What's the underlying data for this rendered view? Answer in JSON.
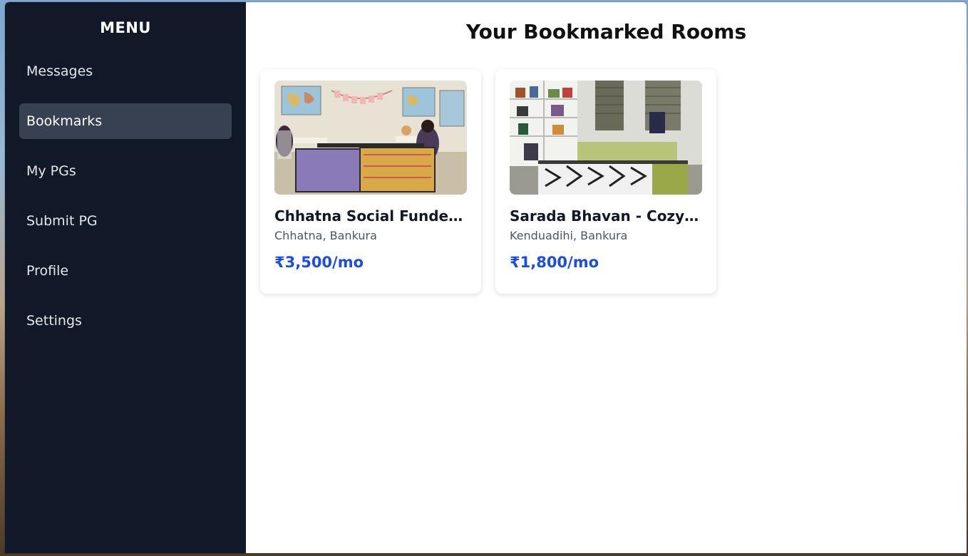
{
  "sidebar": {
    "title": "MENU",
    "items": [
      {
        "label": "Messages",
        "active": false
      },
      {
        "label": "Bookmarks",
        "active": true
      },
      {
        "label": "My PGs",
        "active": false
      },
      {
        "label": "Submit PG",
        "active": false
      },
      {
        "label": "Profile",
        "active": false
      },
      {
        "label": "Settings",
        "active": false
      }
    ]
  },
  "main": {
    "title": "Your Bookmarked Rooms",
    "rooms": [
      {
        "title": "Chhatna Social Funded ...",
        "location": "Chhatna, Bankura",
        "price": "₹3,500/mo"
      },
      {
        "title": "Sarada Bhavan - Cozy R...",
        "location": "Kenduadihi, Bankura",
        "price": "₹1,800/mo"
      }
    ]
  },
  "colors": {
    "sidebar_bg": "#111827",
    "active_item_bg": "#374151",
    "price": "#1d4ed8"
  }
}
